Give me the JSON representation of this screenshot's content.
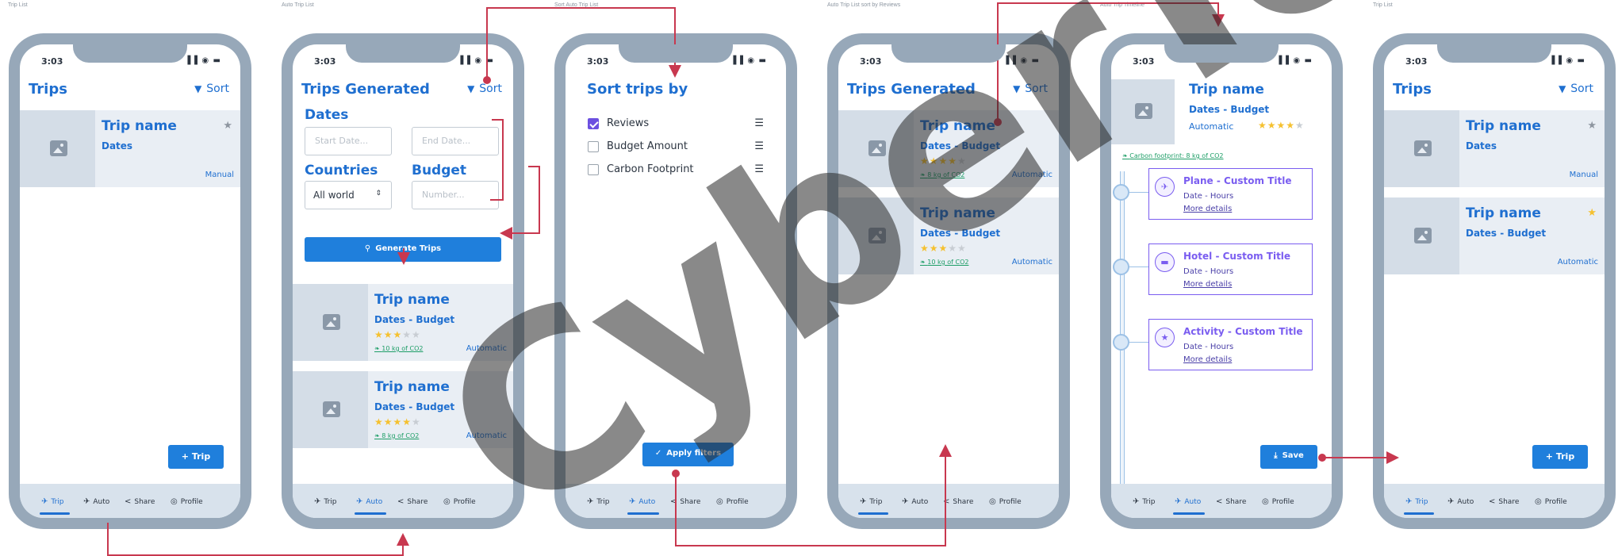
{
  "screen_labels": [
    "Trip List",
    "Auto Trip List",
    "Sort Auto Trip List",
    "Auto Trip List sort by Reviews",
    "Auto Trip Timeline",
    "Trip List"
  ],
  "status": {
    "time": "3:03",
    "icons": "▐▐ ◉ ▬"
  },
  "common": {
    "sort_label": "Sort",
    "tabs": [
      {
        "label": "Trip",
        "icon": "plane-icon",
        "glyph": "✈"
      },
      {
        "label": "Auto",
        "icon": "auto-icon",
        "glyph": "✈"
      },
      {
        "label": "Share",
        "icon": "share-icon",
        "glyph": "<"
      },
      {
        "label": "Profile",
        "icon": "profile-icon",
        "glyph": "◎"
      }
    ],
    "add_trip": "+ Trip"
  },
  "screen1": {
    "title": "Trips",
    "cards": [
      {
        "name": "Trip name",
        "dates": "Dates",
        "type": "Manual"
      }
    ]
  },
  "screen2": {
    "title": "Trips Generated",
    "dates_label": "Dates",
    "start_placeholder": "Start Date...",
    "end_placeholder": "End Date...",
    "countries_label": "Countries",
    "budget_label": "Budget",
    "countries_value": "All world",
    "budget_placeholder": "Number...",
    "generate_button": "Generate Trips",
    "cards": [
      {
        "name": "Trip name",
        "dates": "Dates - Budget",
        "stars": 3,
        "co2": "10 kg of CO2",
        "type": "Automatic"
      },
      {
        "name": "Trip name",
        "dates": "Dates - Budget",
        "stars": 4,
        "co2": "8 kg of CO2",
        "type": "Automatic"
      }
    ]
  },
  "screen3": {
    "title": "Sort trips by",
    "options": [
      {
        "label": "Reviews",
        "checked": true
      },
      {
        "label": "Budget Amount",
        "checked": false
      },
      {
        "label": "Carbon Footprint",
        "checked": false
      }
    ],
    "apply_button": "Apply filters"
  },
  "screen4": {
    "title": "Trips Generated",
    "cards": [
      {
        "name": "Trip name",
        "dates": "Dates - Budget",
        "stars": 4,
        "co2": "8 kg of CO2",
        "type": "Automatic"
      },
      {
        "name": "Trip name",
        "dates": "Dates - Budget",
        "stars": 3,
        "co2": "10 kg of CO2",
        "type": "Automatic"
      }
    ]
  },
  "screen5": {
    "trip_name": "Trip name",
    "dates": "Dates - Budget",
    "type": "Automatic",
    "stars": 4,
    "carbon": "Carbon footprint: 8 kg of CO2",
    "items": [
      {
        "title": "Plane - Custom Title",
        "sub": "Date - Hours",
        "more": "More details",
        "icon": "plane-icon",
        "glyph": "✈"
      },
      {
        "title": "Hotel - Custom Title",
        "sub": "Date - Hours",
        "more": "More details",
        "icon": "hotel-icon",
        "glyph": "▬"
      },
      {
        "title": "Activity - Custom Title",
        "sub": "Date - Hours",
        "more": "More details",
        "icon": "activity-icon",
        "glyph": "★"
      }
    ],
    "save_button": "Save"
  },
  "screen6": {
    "title": "Trips",
    "cards": [
      {
        "name": "Trip name",
        "dates": "Dates",
        "type": "Manual",
        "starred": false
      },
      {
        "name": "Trip name",
        "dates": "Dates - Budget",
        "type": "Automatic",
        "starred": true
      }
    ]
  },
  "watermark": "CyberTo",
  "colors": {
    "accent": "#1f6fd0",
    "button": "#1f7fdc",
    "arrow": "#c8384f",
    "frame": "#97a8b9",
    "timeline": "#7a5df0",
    "star": "#f5c130"
  }
}
